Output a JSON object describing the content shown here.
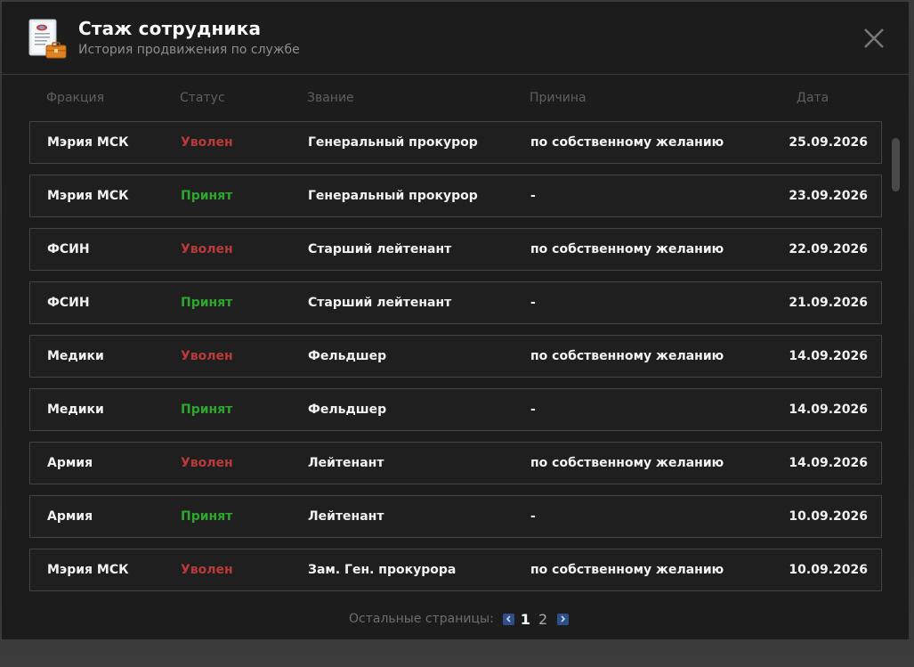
{
  "header": {
    "title": "Стаж сотрудника",
    "subtitle": "История продвижения по службе"
  },
  "columns": {
    "faction": "Фракция",
    "status": "Статус",
    "rank": "Звание",
    "reason": "Причина",
    "date": "Дата"
  },
  "colors": {
    "fired": "#b83a3a",
    "hired": "#2fa52f",
    "accent": "#2e4f8a"
  },
  "rows": [
    {
      "faction": "Мэрия МСК",
      "status": "Уволен",
      "status_type": "fired",
      "rank": "Генеральный прокурор",
      "reason": "по собственному желанию",
      "date": "25.09.2026"
    },
    {
      "faction": "Мэрия МСК",
      "status": "Принят",
      "status_type": "hired",
      "rank": "Генеральный прокурор",
      "reason": "-",
      "date": "23.09.2026"
    },
    {
      "faction": "ФСИН",
      "status": "Уволен",
      "status_type": "fired",
      "rank": "Старший лейтенант",
      "reason": "по собственному желанию",
      "date": "22.09.2026"
    },
    {
      "faction": "ФСИН",
      "status": "Принят",
      "status_type": "hired",
      "rank": "Старший лейтенант",
      "reason": "-",
      "date": "21.09.2026"
    },
    {
      "faction": "Медики",
      "status": "Уволен",
      "status_type": "fired",
      "rank": "Фельдшер",
      "reason": "по собственному желанию",
      "date": "14.09.2026"
    },
    {
      "faction": "Медики",
      "status": "Принят",
      "status_type": "hired",
      "rank": "Фельдшер",
      "reason": "-",
      "date": "14.09.2026"
    },
    {
      "faction": "Армия",
      "status": "Уволен",
      "status_type": "fired",
      "rank": "Лейтенант",
      "reason": "по собственному желанию",
      "date": "14.09.2026"
    },
    {
      "faction": "Армия",
      "status": "Принят",
      "status_type": "hired",
      "rank": "Лейтенант",
      "reason": "-",
      "date": "10.09.2026"
    },
    {
      "faction": "Мэрия МСК",
      "status": "Уволен",
      "status_type": "fired",
      "rank": "Зам. Ген. прокурора",
      "reason": "по собственному желанию",
      "date": "10.09.2026"
    }
  ],
  "pagination": {
    "label": "Остальные страницы:",
    "pages": [
      "1",
      "2"
    ],
    "current": "1"
  }
}
